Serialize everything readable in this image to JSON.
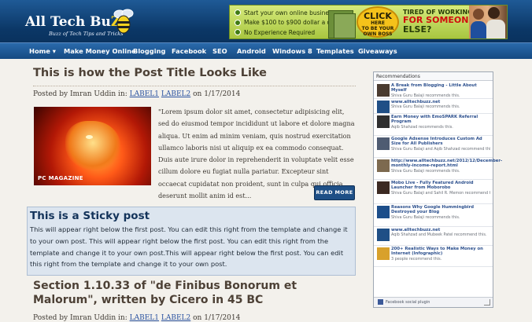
{
  "logo": {
    "part1": "All Tech Bu",
    "part2": "ZZ",
    "tagline": "Buzz of Tech Tips and Tricks"
  },
  "banner": {
    "bullets": [
      "Start your own online business today",
      "Make $100 to $900 dollar a day",
      "No Experience Required"
    ],
    "click_line1": "CLICK",
    "click_line2": "HERE",
    "click_line3": "TO BE YOUR OWN BOSS",
    "tired_line1": "TIRED OF WORKING",
    "tired_line2": "FOR SOMEONE",
    "tired_line3": "ELSE?"
  },
  "nav": [
    "Home ▾",
    "Make Money Online",
    "Blogging",
    "Facebook",
    "SEO",
    "Android",
    "Windows 8",
    "Templates",
    "Giveaways"
  ],
  "post1": {
    "title": "This is how the Post Title Looks Like",
    "posted_by": "Posted by Imran Uddin in:",
    "label1": "LABEL1",
    "label2": "LABEL2",
    "date": "on 1/17/2014",
    "thumb_brand": "PC MAGAZINE",
    "excerpt": "\"Lorem ipsum dolor sit amet, consectetur adipisicing elit, sed do eiusmod tempor incididunt ut labore et dolore magna aliqua. Ut enim ad minim veniam, quis nostrud exercitation ullamco laboris nisi ut aliquip ex ea commodo consequat. Duis aute irure dolor in reprehenderit in voluptate velit esse cillum dolore eu fugiat nulla pariatur. Excepteur sint occaecat cupidatat non proident, sunt in culpa qui officia deserunt mollit anim id est...",
    "read_more": "READ MORE"
  },
  "sticky": {
    "title": "This is a Sticky post",
    "body": "This will appear right below the first post. You can edit this right from the template and change it to your own post. This will appear right below the first post. You can edit this right from the template and change it to your own post.This will appear right below the first post. You can edit this right from the template and change it to your own post."
  },
  "post2": {
    "title": "Section 1.10.33 of \"de Finibus Bonorum et Malorum\", written by Cicero in 45 BC",
    "posted_by": "Posted by Imran Uddin in:",
    "label1": "LABEL1",
    "label2": "LABEL2",
    "date": "on 1/17/2014"
  },
  "recommendations": {
    "header": "Recommendations",
    "footer": "Facebook social plugin",
    "items": [
      {
        "title": "A Break from Blogging - Little About Myself",
        "sub": "Shiva Guru Balaji recommends this.",
        "color": "#4a3b2f"
      },
      {
        "title": "www.alltechbuzz.net",
        "sub": "Shiva Guru Balaji recommends this.",
        "color": "#1f4f86"
      },
      {
        "title": "Earn Money with EmoSPARK Referral Program",
        "sub": "Aqib Shahzad recommends this.",
        "color": "#2f2f2f"
      },
      {
        "title": "Google Adsense Introduces Custom Ad Size for All Publishers",
        "sub": "Shiva Guru Balaji and Aqib Shahzad recommend this.",
        "color": "#4f5c72"
      },
      {
        "title": "http://www.alltechbuzz.net/2012/12/December-monthly-income-report.html",
        "sub": "Shiva Guru Balaji recommends this.",
        "color": "#7d6a4f"
      },
      {
        "title": "Mobo Live - Fully Featured Android Launcher from Moborobo",
        "sub": "Shiva Guru Balaji and Sahil R. Memon recommend this.",
        "color": "#3c2a22"
      },
      {
        "title": "Reasons Why Google Hummingbird Destroyed your Blog",
        "sub": "Shiva Guru Balaji recommends this.",
        "color": "#1c4e8a"
      },
      {
        "title": "www.alltechbuzz.net",
        "sub": "Aqib Shahzad and Mubeek Patel recommend this.",
        "color": "#1f4f86"
      },
      {
        "title": "200+ Realistic Ways to Make Money on Internet (Infographic)",
        "sub": "3 people recommend this.",
        "color": "#d8a12b"
      }
    ]
  }
}
